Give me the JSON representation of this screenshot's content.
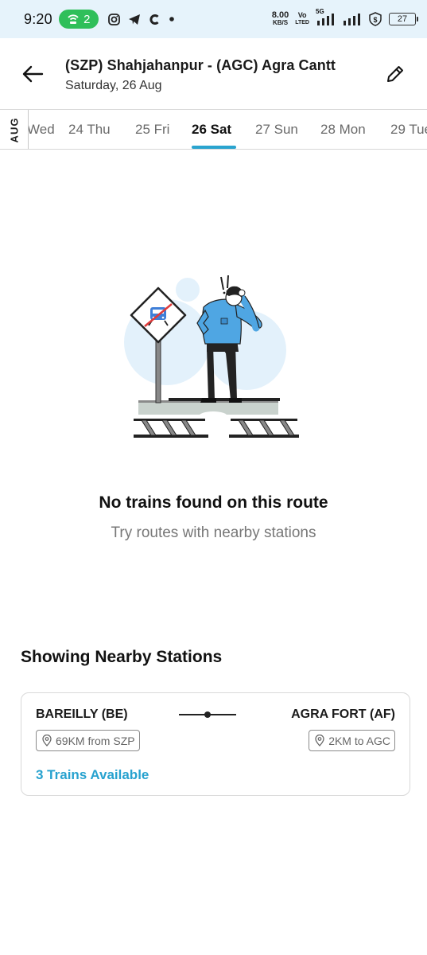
{
  "status_bar": {
    "time": "9:20",
    "hotspot_count": "2",
    "net_speed_value": "8.00",
    "net_speed_unit": "KB/S",
    "volte_top": "Vo",
    "volte_bottom": "LTED",
    "network_label": "5G",
    "battery_level": "27"
  },
  "header": {
    "route_title": "(SZP) Shahjahanpur - (AGC) Agra Cantt",
    "route_date": "Saturday, 26 Aug"
  },
  "date_strip": {
    "month": "AUG",
    "dates": [
      {
        "label": "Wed",
        "selected": false
      },
      {
        "label": "24 Thu",
        "selected": false
      },
      {
        "label": "25 Fri",
        "selected": false
      },
      {
        "label": "26 Sat",
        "selected": true
      },
      {
        "label": "27 Sun",
        "selected": false
      },
      {
        "label": "28 Mon",
        "selected": false
      },
      {
        "label": "29 Tue",
        "selected": false
      }
    ]
  },
  "empty_state": {
    "title": "No trains found on this route",
    "subtitle": "Try routes with nearby stations"
  },
  "nearby": {
    "section_title": "Showing Nearby Stations",
    "card": {
      "from_station": "BAREILLY (BE)",
      "to_station": "AGRA FORT (AF)",
      "from_distance": "69KM from SZP",
      "to_distance": "2KM to AGC",
      "trains_available": "3 Trains Available"
    }
  },
  "colors": {
    "accent": "#2aa4cf",
    "status_bar_bg": "#e6f3fb",
    "hotspot_green": "#2fbf5a"
  }
}
